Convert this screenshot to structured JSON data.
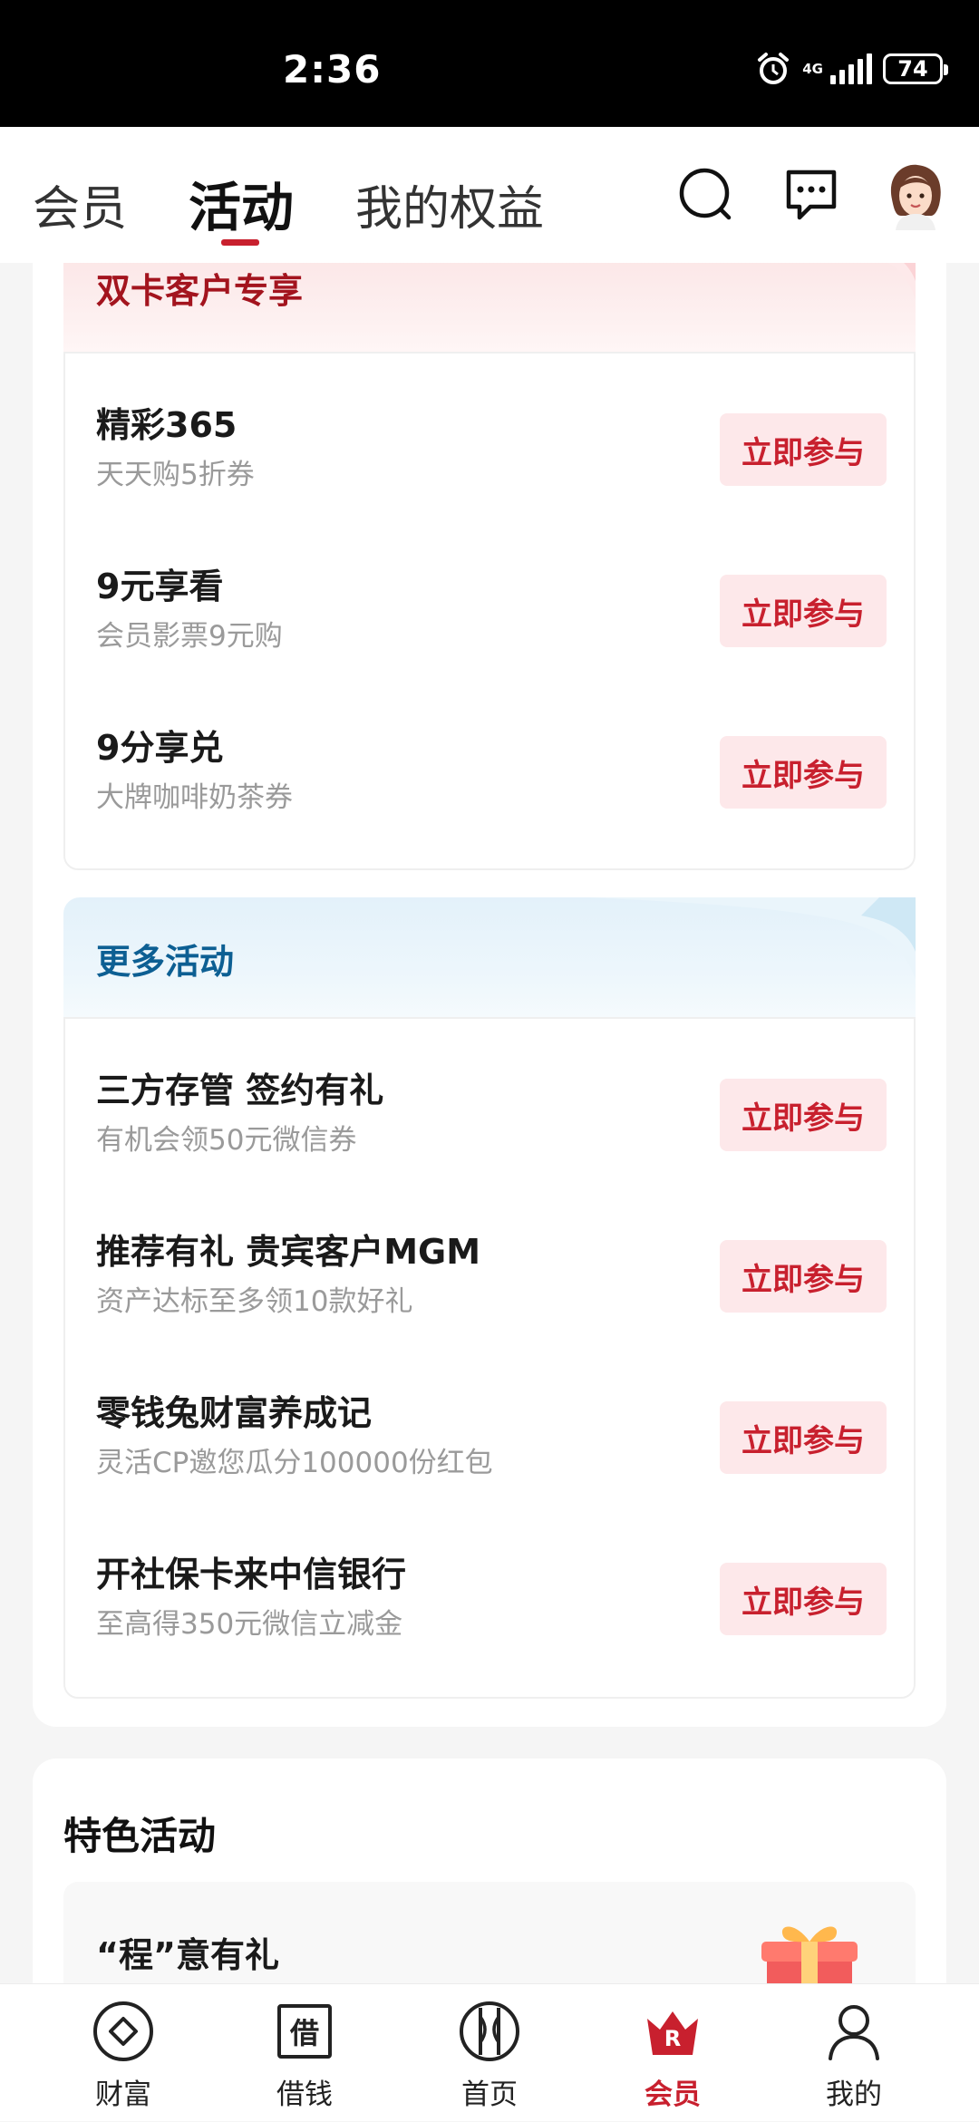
{
  "status_bar": {
    "time": "2:36",
    "network": "4G",
    "battery": "74"
  },
  "top_nav": {
    "tabs": [
      {
        "label": "会员"
      },
      {
        "label": "活动"
      },
      {
        "label": "我的权益"
      }
    ]
  },
  "sections": [
    {
      "title": "双卡客户专享",
      "items": [
        {
          "title": "精彩365",
          "subtitle": "天天购5折券",
          "button": "立即参与"
        },
        {
          "title": "9元享看",
          "subtitle": "会员影票9元购",
          "button": "立即参与"
        },
        {
          "title": "9分享兑",
          "subtitle": "大牌咖啡奶茶券",
          "button": "立即参与"
        }
      ]
    },
    {
      "title": "更多活动",
      "items": [
        {
          "title": "三方存管 签约有礼",
          "subtitle": "有机会领50元微信券",
          "button": "立即参与"
        },
        {
          "title": "推荐有礼 贵宾客户MGM",
          "subtitle": "资产达标至多领10款好礼",
          "button": "立即参与"
        },
        {
          "title": "零钱兔财富养成记",
          "subtitle": "灵活CP邀您瓜分100000份红包",
          "button": "立即参与"
        },
        {
          "title": "开社保卡来中信银行",
          "subtitle": "至高得350元微信立减金",
          "button": "立即参与"
        }
      ]
    }
  ],
  "featured": {
    "title": "特色活动",
    "card_title": "“程”意有礼"
  },
  "bottom_nav": {
    "items": [
      {
        "label": "财富",
        "icon": "wealth-icon"
      },
      {
        "label": "借钱",
        "icon": "borrow-icon"
      },
      {
        "label": "首页",
        "icon": "home-icon"
      },
      {
        "label": "会员",
        "icon": "member-crown-icon"
      },
      {
        "label": "我的",
        "icon": "profile-icon"
      }
    ],
    "icon_glyphs": {
      "borrow": "借",
      "member": "R"
    },
    "active_color": "#c8202e"
  }
}
